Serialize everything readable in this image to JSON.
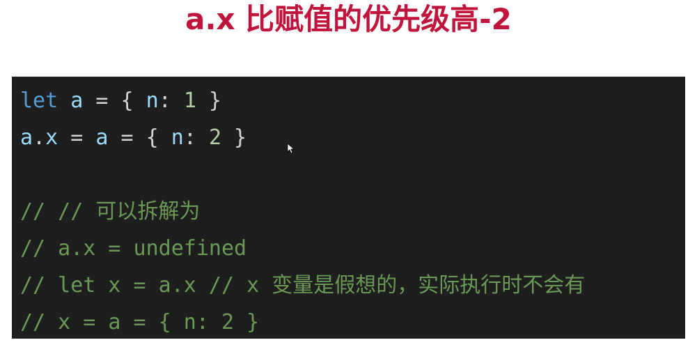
{
  "slide": {
    "title": "a.x 比赋值的优先级高-2"
  },
  "code": {
    "line1": {
      "kw": "let",
      "sp1": " ",
      "var": "a",
      "rest1": " = { ",
      "prop": "n",
      "colon": ": ",
      "num": "1",
      "rest2": " }"
    },
    "line2": {
      "obj": "a",
      "dot": ".",
      "prop": "x",
      "eq1": " = ",
      "var": "a",
      "eq2": " = { ",
      "nprop": "n",
      "colon": ": ",
      "num": "2",
      "close": " }"
    },
    "line4": "// // 可以拆解为",
    "line5": "// a.x = undefined",
    "line6": "// let x = a.x // x 变量是假想的，实际执行时不会有",
    "line7": "// x = a = { n: 2 }"
  },
  "colors": {
    "title": "#c0143c",
    "background": "#1e1e1e",
    "keyword": "#569cd6",
    "variable": "#9cdcfe",
    "number": "#b5cea8",
    "comment": "#6a9955"
  },
  "icons": {
    "cursor": "mouse-pointer-icon"
  }
}
